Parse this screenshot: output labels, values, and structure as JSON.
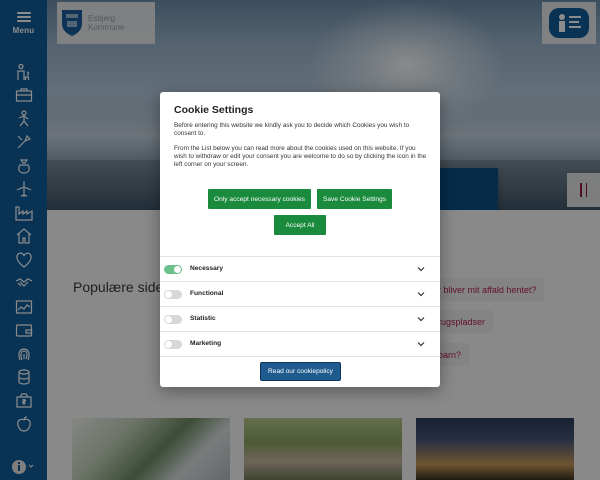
{
  "sidebar": {
    "menu_label": "Menu",
    "icons": [
      "family-icon",
      "briefcase-icon",
      "activity-icon",
      "tools-icon",
      "money-bag-icon",
      "airplane-icon",
      "factory-icon",
      "house-icon",
      "heart-icon",
      "handshake-icon",
      "chart-icon",
      "wallet-icon",
      "fingerprint-icon",
      "stack-icon",
      "dollar-box-icon",
      "apple-icon"
    ],
    "bottom_icon": "info-icon"
  },
  "header": {
    "logo_text_line1": "Esbjerg",
    "logo_text_line2": "Kommune",
    "partner_badge": "partner-badge-icon"
  },
  "hero": {
    "pause_icon": "pause-icon"
  },
  "background": {
    "popular_title": "Populære sider",
    "quick_links": [
      "r bliver mit affald hentet?",
      "rugspladser",
      "barn?"
    ]
  },
  "cookie_dialog": {
    "title": "Cookie Settings",
    "text1": "Before entering this website we kindly ask you to decide which Cookies you wish to consent to.",
    "text2": "From the List below you can read more about the cookies used on this website. If you wish to withdraw or edit your consent you are welcome to do so by clicking the icon in the left corner on your screen.",
    "btn_only_necessary": "Only accept necessary cookies",
    "btn_save": "Save Cookie Settings",
    "btn_accept_all": "Accept All",
    "categories": [
      {
        "label": "Necessary",
        "enabled": true
      },
      {
        "label": "Functional",
        "enabled": false
      },
      {
        "label": "Statistic",
        "enabled": false
      },
      {
        "label": "Marketing",
        "enabled": false
      }
    ],
    "read_policy": "Read our cookiepolicy"
  },
  "colors": {
    "sidebar": "#0f5e9c",
    "green_button": "#1a8a3c",
    "policy_button": "#1f5b8f",
    "toggle_on": "#6cc18a",
    "link_accent": "#b3244f"
  }
}
